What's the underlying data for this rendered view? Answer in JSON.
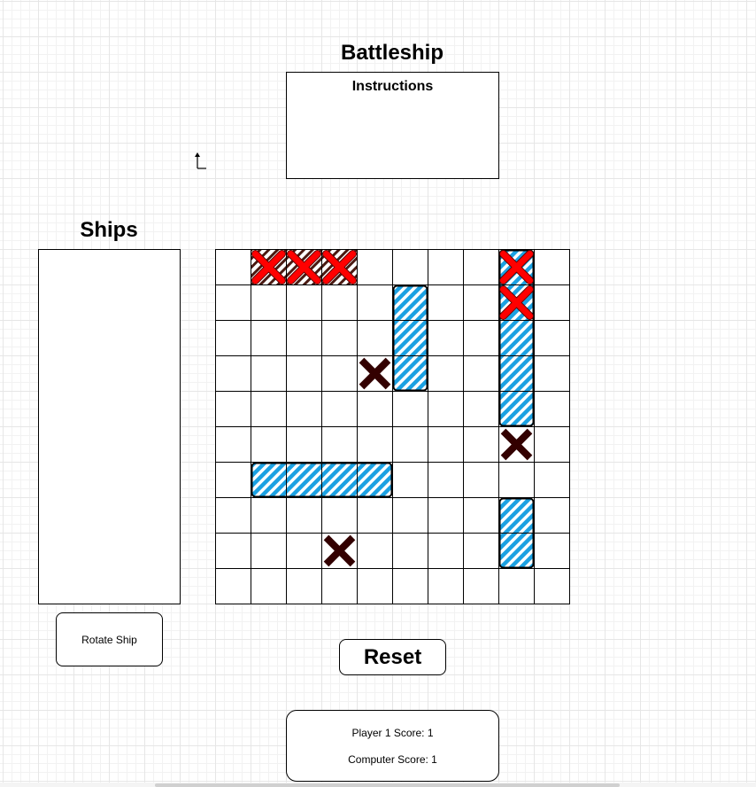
{
  "app": {
    "title": "Battleship"
  },
  "instructions": {
    "title": "Instructions"
  },
  "ships_panel": {
    "title": "Ships"
  },
  "controls": {
    "rotate_label": "Rotate Ship",
    "reset_label": "Reset"
  },
  "scores": {
    "player": "Player 1 Score: 1",
    "computer": "Computer Score: 1"
  },
  "board": {
    "rows": 10,
    "cols": 10,
    "ships": [
      {
        "id": "ship-1",
        "row": 1,
        "col": 5,
        "length": 3,
        "orientation": "vertical",
        "hits": 0,
        "status": "afloat"
      },
      {
        "id": "ship-2",
        "row": 0,
        "col": 8,
        "length": 5,
        "orientation": "vertical",
        "hits": 2,
        "status": "afloat"
      },
      {
        "id": "ship-3",
        "row": 6,
        "col": 1,
        "length": 4,
        "orientation": "horizontal",
        "hits": 0,
        "status": "afloat"
      },
      {
        "id": "ship-4",
        "row": 7,
        "col": 8,
        "length": 2,
        "orientation": "vertical",
        "hits": 0,
        "status": "afloat"
      },
      {
        "id": "ship-5",
        "row": 0,
        "col": 1,
        "length": 3,
        "orientation": "horizontal",
        "hits": 3,
        "status": "sunk"
      }
    ],
    "hits": [
      {
        "row": 0,
        "col": 1
      },
      {
        "row": 0,
        "col": 2
      },
      {
        "row": 0,
        "col": 3
      },
      {
        "row": 0,
        "col": 8
      },
      {
        "row": 1,
        "col": 8
      }
    ],
    "misses": [
      {
        "row": 3,
        "col": 4
      },
      {
        "row": 5,
        "col": 8
      },
      {
        "row": 8,
        "col": 3
      }
    ]
  },
  "colors": {
    "ship_hatch": "#1ba1e2",
    "sunk_hatch": "#4a1a12",
    "hit_marker": "#ff0000",
    "miss_marker": "#330000",
    "grid_line": "#000000"
  },
  "icons": {
    "cursor": "cursor-arrow-icon"
  }
}
